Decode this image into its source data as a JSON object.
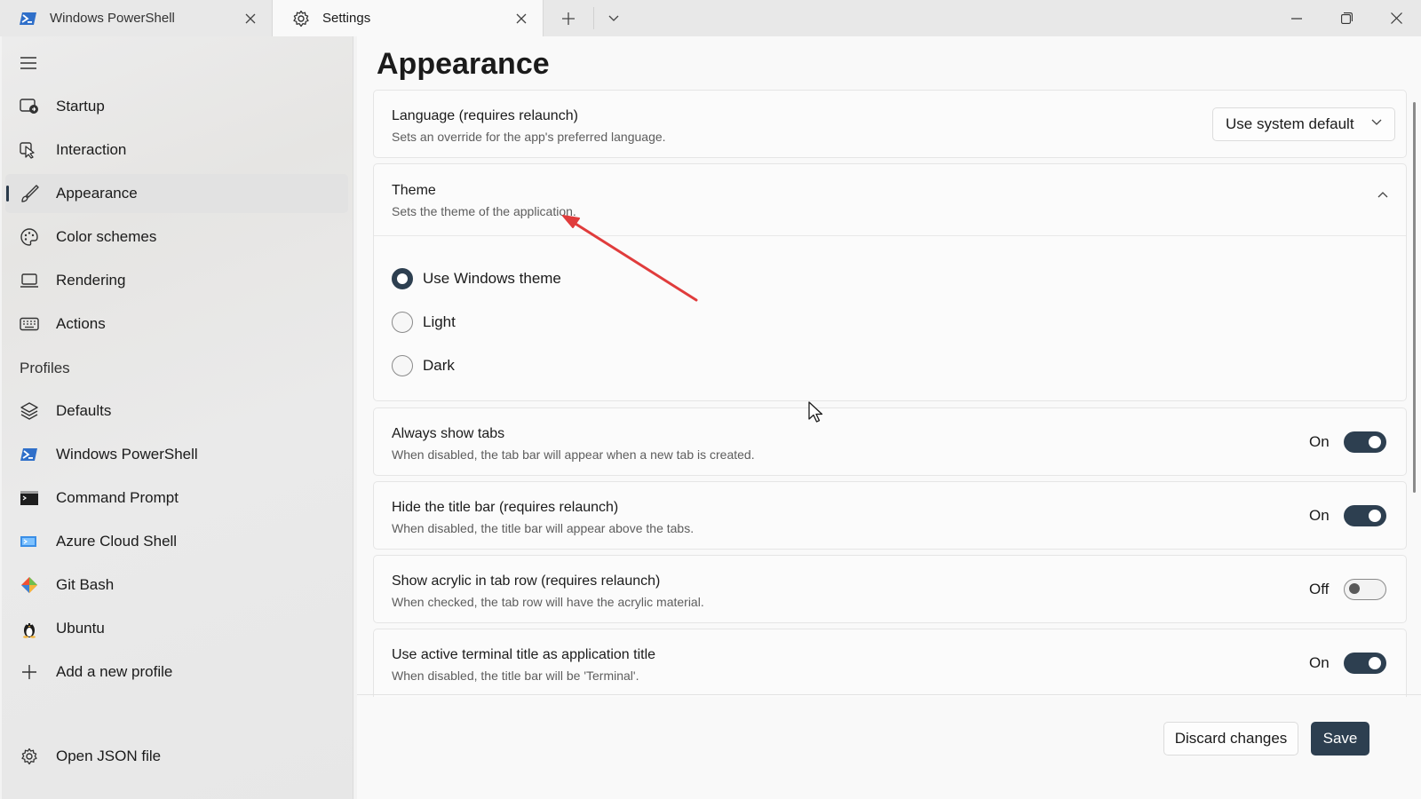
{
  "tabs": [
    {
      "title": "Windows PowerShell",
      "icon": "powershell-icon",
      "active": false
    },
    {
      "title": "Settings",
      "icon": "gear-icon",
      "active": true
    }
  ],
  "sidebar": {
    "items": [
      {
        "label": "Startup",
        "icon": "startup-icon"
      },
      {
        "label": "Interaction",
        "icon": "interaction-icon"
      },
      {
        "label": "Appearance",
        "icon": "paintbrush-icon",
        "selected": true
      },
      {
        "label": "Color schemes",
        "icon": "palette-icon"
      },
      {
        "label": "Rendering",
        "icon": "monitor-icon"
      },
      {
        "label": "Actions",
        "icon": "keyboard-icon"
      }
    ],
    "profiles_header": "Profiles",
    "profiles": [
      {
        "label": "Defaults",
        "icon": "layers-icon"
      },
      {
        "label": "Windows PowerShell",
        "icon": "powershell-icon"
      },
      {
        "label": "Command Prompt",
        "icon": "cmd-icon"
      },
      {
        "label": "Azure Cloud Shell",
        "icon": "azure-icon"
      },
      {
        "label": "Git Bash",
        "icon": "git-icon"
      },
      {
        "label": "Ubuntu",
        "icon": "linux-icon"
      },
      {
        "label": "Add a new profile",
        "icon": "plus-icon"
      }
    ],
    "open_json": {
      "label": "Open JSON file",
      "icon": "gear-icon"
    }
  },
  "main": {
    "title": "Appearance",
    "language": {
      "title": "Language (requires relaunch)",
      "desc": "Sets an override for the app's preferred language.",
      "value": "Use system default"
    },
    "theme": {
      "title": "Theme",
      "desc": "Sets the theme of the application.",
      "options": [
        "Use Windows theme",
        "Light",
        "Dark"
      ],
      "selected_index": 0
    },
    "settings": [
      {
        "title": "Always show tabs",
        "desc": "When disabled, the tab bar will appear when a new tab is created.",
        "state": "On"
      },
      {
        "title": "Hide the title bar (requires relaunch)",
        "desc": "When disabled, the title bar will appear above the tabs.",
        "state": "On"
      },
      {
        "title": "Show acrylic in tab row (requires relaunch)",
        "desc": "When checked, the tab row will have the acrylic material.",
        "state": "Off"
      },
      {
        "title": "Use active terminal title as application title",
        "desc": "When disabled, the title bar will be 'Terminal'.",
        "state": "On"
      }
    ],
    "buttons": {
      "discard": "Discard changes",
      "save": "Save"
    }
  },
  "colors": {
    "accent": "#2d3f50",
    "annotation_arrow": "#e03c3c"
  }
}
